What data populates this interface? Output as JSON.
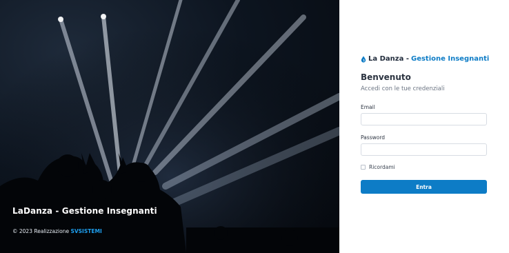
{
  "hero": {
    "title": "LaDanza - Gestione Insegnanti",
    "footer_prefix": "© 2023 Realizzazione ",
    "footer_brand": "SVSISTEMI"
  },
  "login": {
    "logo_name": "La Danza - ",
    "logo_accent": "Gestione Insegnanti",
    "logo_icon": "drop-icon",
    "welcome": "Benvenuto",
    "subtitle": "Accedi con le tue credenziali",
    "email_label": "Email",
    "email_value": "",
    "password_label": "Password",
    "password_value": "",
    "remember_label": "Ricordami",
    "remember_checked": false,
    "submit_label": "Entra"
  },
  "colors": {
    "accent": "#0d7cc6",
    "brand_link": "#1ea0f0",
    "hero_bg": "#0d1520"
  }
}
